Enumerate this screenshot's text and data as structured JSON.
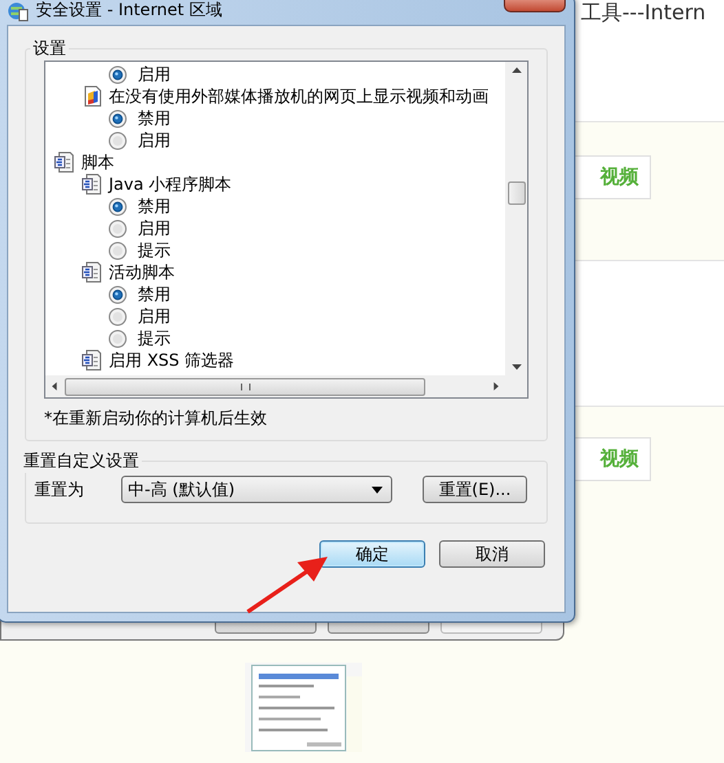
{
  "window": {
    "title": "安全设置 - Internet 区域"
  },
  "settings_group": {
    "title": "设置",
    "items": [
      {
        "kind": "category",
        "children": [
          {
            "kind": "script",
            "children": [
              {
                "kind": "option",
                "label": "启用",
                "selected": true
              }
            ]
          },
          {
            "kind": "media",
            "label": "在没有使用外部媒体播放机的网页上显示视频和动画",
            "children": [
              {
                "kind": "option",
                "label": "禁用",
                "selected": true
              },
              {
                "kind": "option",
                "label": "启用",
                "selected": false
              }
            ]
          }
        ]
      },
      {
        "kind": "category",
        "label": "脚本",
        "children": [
          {
            "kind": "script",
            "label": "Java 小程序脚本",
            "children": [
              {
                "kind": "option",
                "label": "禁用",
                "selected": true
              },
              {
                "kind": "option",
                "label": "启用",
                "selected": false
              },
              {
                "kind": "option",
                "label": "提示",
                "selected": false
              }
            ]
          },
          {
            "kind": "script",
            "label": "活动脚本",
            "children": [
              {
                "kind": "option",
                "label": "禁用",
                "selected": true
              },
              {
                "kind": "option",
                "label": "启用",
                "selected": false
              },
              {
                "kind": "option",
                "label": "提示",
                "selected": false
              }
            ]
          },
          {
            "kind": "script",
            "label": "启用 XSS 筛选器"
          }
        ]
      }
    ],
    "note": "*在重新启动你的计算机后生效"
  },
  "reset_group": {
    "title": "重置自定义设置",
    "label": "重置为",
    "dropdown": {
      "value": "中-高 (默认值)"
    },
    "button": "重置(E)..."
  },
  "buttons": [
    {
      "label": "确定",
      "default": true
    },
    {
      "label": "取消",
      "default": false
    }
  ],
  "background": {
    "heading": "工具---Intern",
    "links": [
      "视频",
      "视频"
    ]
  }
}
